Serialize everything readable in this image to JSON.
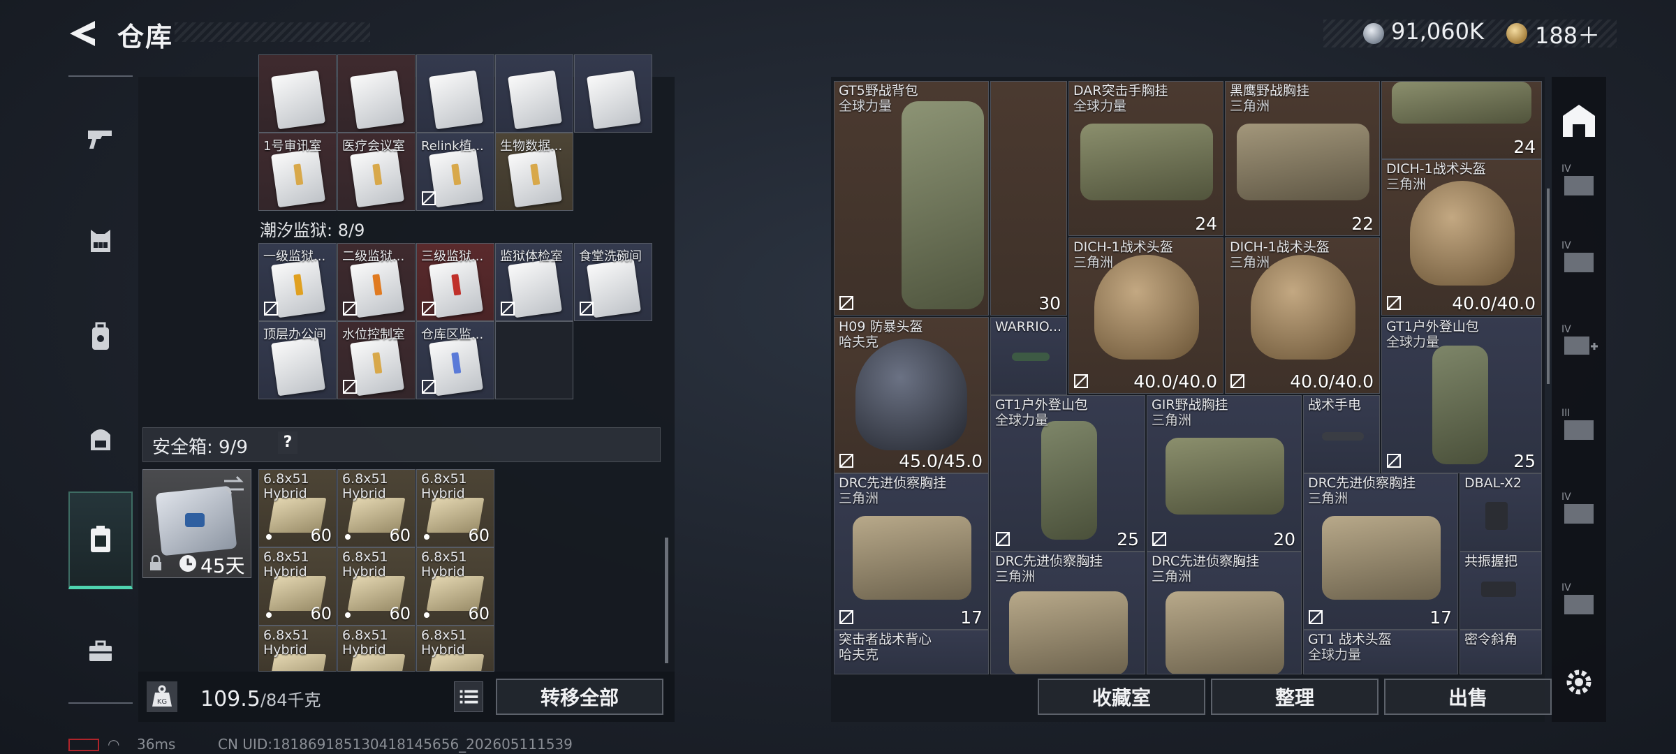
{
  "header": {
    "title": "仓库",
    "silver_currency": "91,060K",
    "gold_currency": "188＋"
  },
  "nav": {
    "items": [
      "weapons",
      "chest-rig",
      "backpack",
      "bag",
      "secure-container",
      "toolbox"
    ],
    "active": "secure-container"
  },
  "keycards": {
    "row1_labels": [
      "1号审讯室",
      "医疗会议室",
      "Relink植...",
      "生物数据..."
    ],
    "section_label": "潮汐监狱: 8/9",
    "row2_labels": [
      "一级监狱...",
      "二级监狱...",
      "三级监狱...",
      "监狱体检室",
      "食堂洗碗间"
    ],
    "row3_labels": [
      "顶层办公间",
      "水位控制室",
      "仓库区监..."
    ]
  },
  "safebox": {
    "label": "安全箱: 9/9",
    "help": "?",
    "timer": "45天",
    "ammo": [
      {
        "name": "6.8x51\nHybrid",
        "count": "60"
      },
      {
        "name": "6.8x51\nHybrid",
        "count": "60"
      },
      {
        "name": "6.8x51\nHybrid",
        "count": "60"
      },
      {
        "name": "6.8x51\nHybrid",
        "count": "60"
      },
      {
        "name": "6.8x51\nHybrid",
        "count": "60"
      },
      {
        "name": "6.8x51\nHybrid",
        "count": "60"
      },
      {
        "name": "6.8x51\nHybrid",
        "count": ""
      },
      {
        "name": "6.8x51\nHybrid",
        "count": ""
      },
      {
        "name": "6.8x51\nHybrid",
        "count": ""
      }
    ]
  },
  "left_bottom": {
    "weight_value": "109.5",
    "weight_capacity": "/84千克",
    "transfer_all": "转移全部"
  },
  "stash": {
    "items": [
      {
        "name": "GT5野战背包",
        "sub": "全球力量",
        "val": ""
      },
      {
        "name": "DAR突击手胸挂",
        "sub": "全球力量",
        "val": "24"
      },
      {
        "name": "黑鹰野战胸挂",
        "sub": "三角洲",
        "val": "22"
      },
      {
        "name": "",
        "sub": "",
        "val": "24"
      },
      {
        "name": "DICH-1战术头盔",
        "sub": "三角洲",
        "val": "40.0/40.0"
      },
      {
        "name": "DICH-1战术头盔",
        "sub": "三角洲",
        "val": "40.0/40.0"
      },
      {
        "name": "DICH-1战术头盔",
        "sub": "三角洲",
        "val": "40.0/40.0"
      },
      {
        "name": "",
        "sub": "",
        "val": "30"
      },
      {
        "name": "H09 防暴头盔",
        "sub": "哈夫克",
        "val": "45.0/45.0"
      },
      {
        "name": "WARRIO...",
        "sub": "",
        "val": ""
      },
      {
        "name": "GT1户外登山包",
        "sub": "全球力量",
        "val": "25"
      },
      {
        "name": "GT1户外登山包",
        "sub": "全球力量",
        "val": "25"
      },
      {
        "name": "GIR野战胸挂",
        "sub": "三角洲",
        "val": "20"
      },
      {
        "name": "战术手电",
        "sub": "",
        "val": ""
      },
      {
        "name": "DRC先进侦察胸挂",
        "sub": "三角洲",
        "val": "17"
      },
      {
        "name": "DRC先进侦察胸挂",
        "sub": "三角洲",
        "val": "17"
      },
      {
        "name": "DBAL-X2",
        "sub": "",
        "val": ""
      },
      {
        "name": "DRC先进侦察胸挂",
        "sub": "三角洲",
        "val": ""
      },
      {
        "name": "DRC先进侦察胸挂",
        "sub": "三角洲",
        "val": ""
      },
      {
        "name": "共振握把",
        "sub": "",
        "val": ""
      },
      {
        "name": "突击者战术背心",
        "sub": "哈夫克",
        "val": ""
      },
      {
        "name": "GT1 战术头盔",
        "sub": "全球力量",
        "val": ""
      },
      {
        "name": "密令斜角",
        "sub": "",
        "val": ""
      }
    ]
  },
  "right_bottom": {
    "collection": "收藏室",
    "organize": "整理",
    "sell": "出售"
  },
  "status": {
    "ping": "36ms",
    "uid": "CN UID:181869185130418145656_202605111539"
  },
  "colors": {
    "accent": "#4fd4b0",
    "cell_red": "#3f2a2e",
    "cell_blue": "#343a4e",
    "cell_tan": "#4d4536",
    "item_brown": "#4b3a30"
  }
}
